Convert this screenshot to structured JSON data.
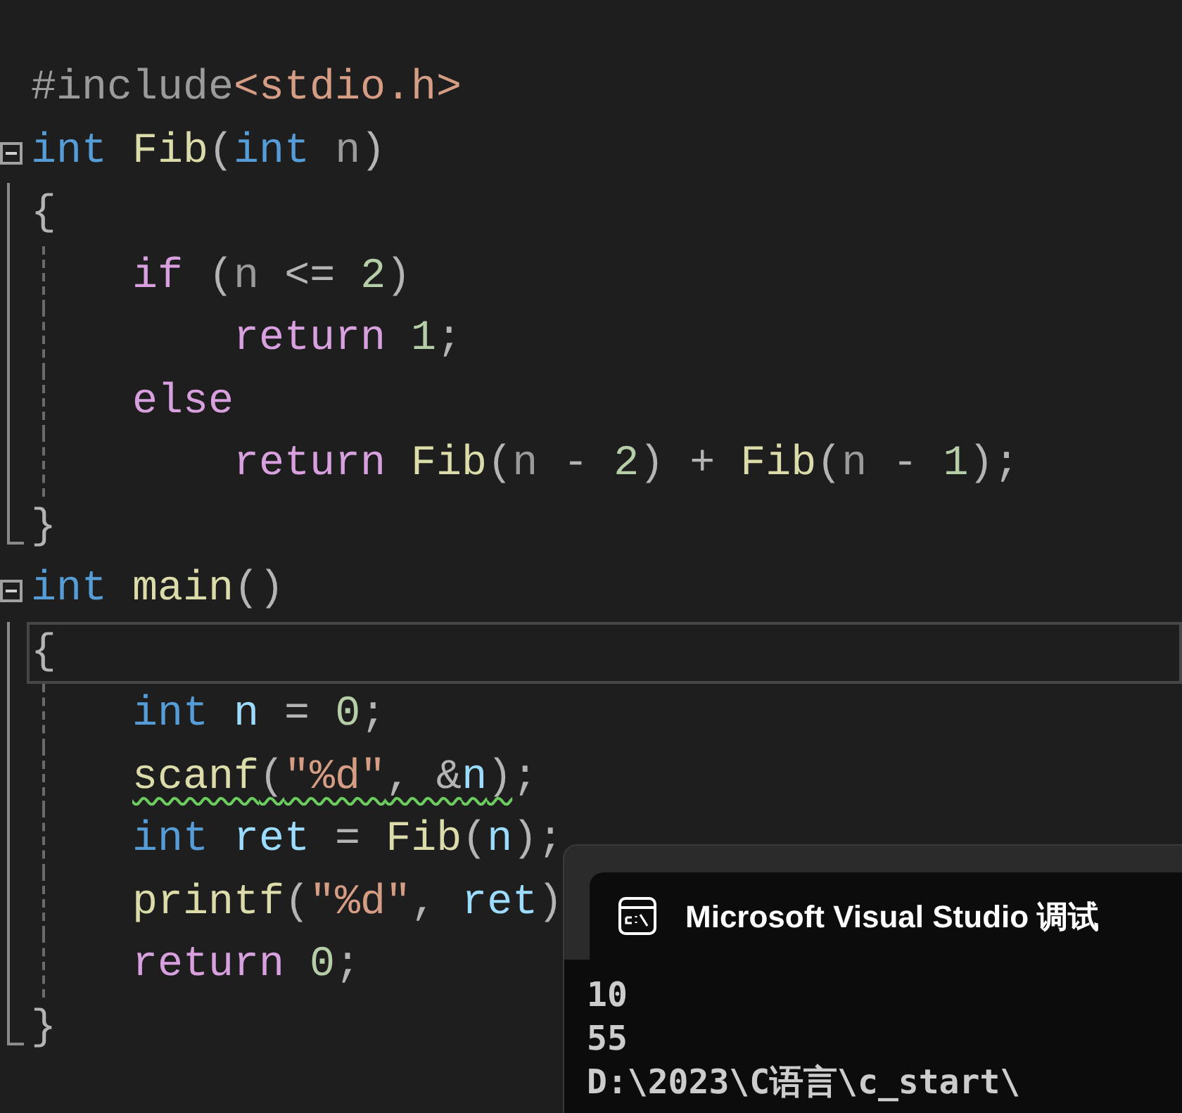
{
  "editor": {
    "lines": [
      {
        "fold_start": false,
        "in_block": false,
        "block_end": false,
        "guide": false,
        "current": false,
        "tokens": [
          {
            "text": "#include",
            "kind": "preproc"
          },
          {
            "text": "<stdio.h>",
            "kind": "header"
          }
        ]
      },
      {
        "fold_start": true,
        "in_block": false,
        "block_end": false,
        "guide": false,
        "current": false,
        "tokens": [
          {
            "text": "int",
            "kind": "keyword"
          },
          {
            "text": " Fib",
            "kind": "function"
          },
          {
            "text": "(",
            "kind": "punct"
          },
          {
            "text": "int",
            "kind": "keyword"
          },
          {
            "text": " n",
            "kind": "param"
          },
          {
            "text": ")",
            "kind": "punct"
          }
        ]
      },
      {
        "fold_start": false,
        "in_block": true,
        "block_end": false,
        "guide": false,
        "current": false,
        "tokens": [
          {
            "text": "{",
            "kind": "punct"
          }
        ]
      },
      {
        "fold_start": false,
        "in_block": true,
        "block_end": false,
        "guide": true,
        "current": false,
        "tokens": [
          {
            "text": "    if",
            "kind": "control"
          },
          {
            "text": " (",
            "kind": "punct"
          },
          {
            "text": "n",
            "kind": "param"
          },
          {
            "text": " <= ",
            "kind": "punct"
          },
          {
            "text": "2",
            "kind": "number"
          },
          {
            "text": ")",
            "kind": "punct"
          }
        ]
      },
      {
        "fold_start": false,
        "in_block": true,
        "block_end": false,
        "guide": true,
        "current": false,
        "tokens": [
          {
            "text": "        return",
            "kind": "control"
          },
          {
            "text": " 1",
            "kind": "number"
          },
          {
            "text": ";",
            "kind": "punct"
          }
        ]
      },
      {
        "fold_start": false,
        "in_block": true,
        "block_end": false,
        "guide": true,
        "current": false,
        "tokens": [
          {
            "text": "    else",
            "kind": "control"
          }
        ]
      },
      {
        "fold_start": false,
        "in_block": true,
        "block_end": false,
        "guide": true,
        "current": false,
        "tokens": [
          {
            "text": "        return",
            "kind": "control"
          },
          {
            "text": " Fib",
            "kind": "function"
          },
          {
            "text": "(",
            "kind": "punct"
          },
          {
            "text": "n",
            "kind": "param"
          },
          {
            "text": " - ",
            "kind": "punct"
          },
          {
            "text": "2",
            "kind": "number"
          },
          {
            "text": ") + ",
            "kind": "punct"
          },
          {
            "text": "Fib",
            "kind": "function"
          },
          {
            "text": "(",
            "kind": "punct"
          },
          {
            "text": "n",
            "kind": "param"
          },
          {
            "text": " - ",
            "kind": "punct"
          },
          {
            "text": "1",
            "kind": "number"
          },
          {
            "text": ");",
            "kind": "punct"
          }
        ]
      },
      {
        "fold_start": false,
        "in_block": false,
        "block_end": true,
        "guide": false,
        "current": false,
        "tokens": [
          {
            "text": "}",
            "kind": "punct"
          }
        ]
      },
      {
        "fold_start": true,
        "in_block": false,
        "block_end": false,
        "guide": false,
        "current": false,
        "tokens": [
          {
            "text": "int",
            "kind": "keyword"
          },
          {
            "text": " main",
            "kind": "function"
          },
          {
            "text": "()",
            "kind": "punct"
          }
        ]
      },
      {
        "fold_start": false,
        "in_block": true,
        "block_end": false,
        "guide": false,
        "current": true,
        "tokens": [
          {
            "text": "{",
            "kind": "punct"
          }
        ]
      },
      {
        "fold_start": false,
        "in_block": true,
        "block_end": false,
        "guide": true,
        "current": false,
        "tokens": [
          {
            "text": "    int",
            "kind": "keyword"
          },
          {
            "text": " n",
            "kind": "local"
          },
          {
            "text": " = ",
            "kind": "punct"
          },
          {
            "text": "0",
            "kind": "number"
          },
          {
            "text": ";",
            "kind": "punct"
          }
        ]
      },
      {
        "fold_start": false,
        "in_block": true,
        "block_end": false,
        "guide": true,
        "current": false,
        "indented": true,
        "tokens": [
          {
            "text": "scanf",
            "kind": "function",
            "warning": true
          },
          {
            "text": "(",
            "kind": "punct",
            "warning": true
          },
          {
            "text": "\"%d\"",
            "kind": "string",
            "warning": true
          },
          {
            "text": ", &",
            "kind": "punct",
            "warning": true
          },
          {
            "text": "n",
            "kind": "local",
            "warning": true
          },
          {
            "text": ")",
            "kind": "punct",
            "warning": true
          },
          {
            "text": ";",
            "kind": "punct"
          }
        ]
      },
      {
        "fold_start": false,
        "in_block": true,
        "block_end": false,
        "guide": true,
        "current": false,
        "tokens": [
          {
            "text": "    int",
            "kind": "keyword"
          },
          {
            "text": " ret",
            "kind": "local"
          },
          {
            "text": " = ",
            "kind": "punct"
          },
          {
            "text": "Fib",
            "kind": "function"
          },
          {
            "text": "(",
            "kind": "punct"
          },
          {
            "text": "n",
            "kind": "local"
          },
          {
            "text": ");",
            "kind": "punct"
          }
        ]
      },
      {
        "fold_start": false,
        "in_block": true,
        "block_end": false,
        "guide": true,
        "current": false,
        "tokens": [
          {
            "text": "    printf",
            "kind": "function"
          },
          {
            "text": "(",
            "kind": "punct"
          },
          {
            "text": "\"%d\"",
            "kind": "string"
          },
          {
            "text": ", ",
            "kind": "punct"
          },
          {
            "text": "ret",
            "kind": "local"
          },
          {
            "text": ")",
            "kind": "punct"
          }
        ]
      },
      {
        "fold_start": false,
        "in_block": true,
        "block_end": false,
        "guide": true,
        "current": false,
        "tokens": [
          {
            "text": "    return",
            "kind": "control"
          },
          {
            "text": " 0",
            "kind": "number"
          },
          {
            "text": ";",
            "kind": "punct"
          }
        ]
      },
      {
        "fold_start": false,
        "in_block": false,
        "block_end": true,
        "guide": false,
        "current": false,
        "tokens": [
          {
            "text": "}",
            "kind": "punct"
          }
        ]
      }
    ]
  },
  "console": {
    "title": "Microsoft Visual Studio 调试",
    "output": [
      "10",
      "55",
      "D:\\2023\\C语言\\c_start\\"
    ]
  }
}
